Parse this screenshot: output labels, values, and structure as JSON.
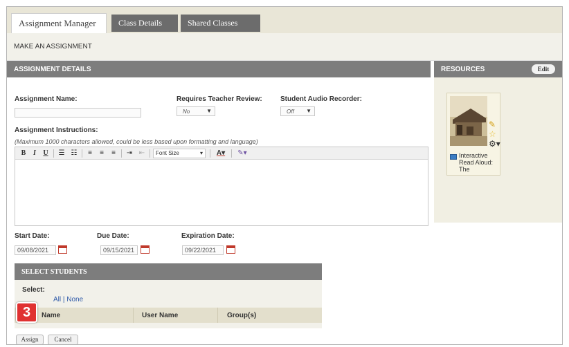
{
  "tabs": [
    {
      "label": "Assignment Manager",
      "active": true
    },
    {
      "label": "Class Details",
      "active": false
    },
    {
      "label": "Shared Classes",
      "active": false
    }
  ],
  "subheader": "MAKE AN ASSIGNMENT",
  "assignment_details": {
    "header": "ASSIGNMENT DETAILS",
    "name_label": "Assignment Name:",
    "name_value": "",
    "review_label": "Requires Teacher Review:",
    "review_value": "No",
    "audio_label": "Student Audio Recorder:",
    "audio_value": "Off",
    "instructions_label": "Assignment Instructions:",
    "instructions_hint": "(Maximum 1000 characters allowed, could be less based upon formatting and language)",
    "font_size_label": "Font Size"
  },
  "dates": {
    "start_label": "Start Date:",
    "start_value": "09/08/2021",
    "due_label": "Due Date:",
    "due_value": "09/15/2021",
    "expiration_label": "Expiration Date:",
    "expiration_value": "09/22/2021"
  },
  "select_students": {
    "header": "SELECT STUDENTS",
    "select_label": "Select:",
    "select_links": "All | None",
    "columns": [
      "Name",
      "User Name",
      "Group(s)"
    ]
  },
  "resources": {
    "header": "RESOURCES",
    "edit_label": "Edit",
    "item_title": "Interactive Read Aloud: The"
  },
  "buttons": {
    "assign": "Assign",
    "cancel": "Cancel"
  },
  "callout": "3",
  "colors": {
    "section_bar": "#7d7d7d",
    "tab_bar": "#e9e6d7",
    "link": "#2f5aa8",
    "callout": "#e03131",
    "calendar_icon": "#c0392b"
  }
}
